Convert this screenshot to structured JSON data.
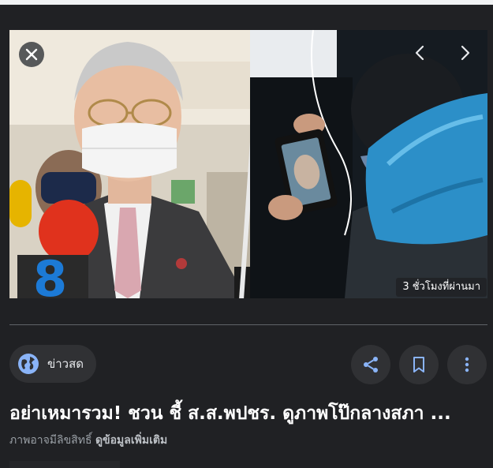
{
  "image_viewer": {
    "time_badge": "3 ชั่วโมงที่ผ่านมา",
    "close_icon": "close-icon",
    "prev_icon": "chevron-left-icon",
    "next_icon": "chevron-right-icon"
  },
  "source": {
    "name": "ข่าวสด",
    "icon": "globe-icon"
  },
  "actions": {
    "share_icon": "share-icon",
    "bookmark_icon": "bookmark-icon",
    "more_icon": "more-vert-icon"
  },
  "article": {
    "title": "อย่าเหมารวม! ชวน ชี้ ส.ส.พปชร. ดูภาพโป๊กลางสภา ...",
    "copyright_notice": "ภาพอาจมีลิขสิทธิ์",
    "more_info_link": "ดูข้อมูลเพิ่มเติม"
  },
  "colors": {
    "background": "#202124",
    "chip_bg": "#303134",
    "link_blue": "#8ab4f8",
    "text_primary": "#ffffff",
    "text_secondary": "#9aa0a6"
  }
}
